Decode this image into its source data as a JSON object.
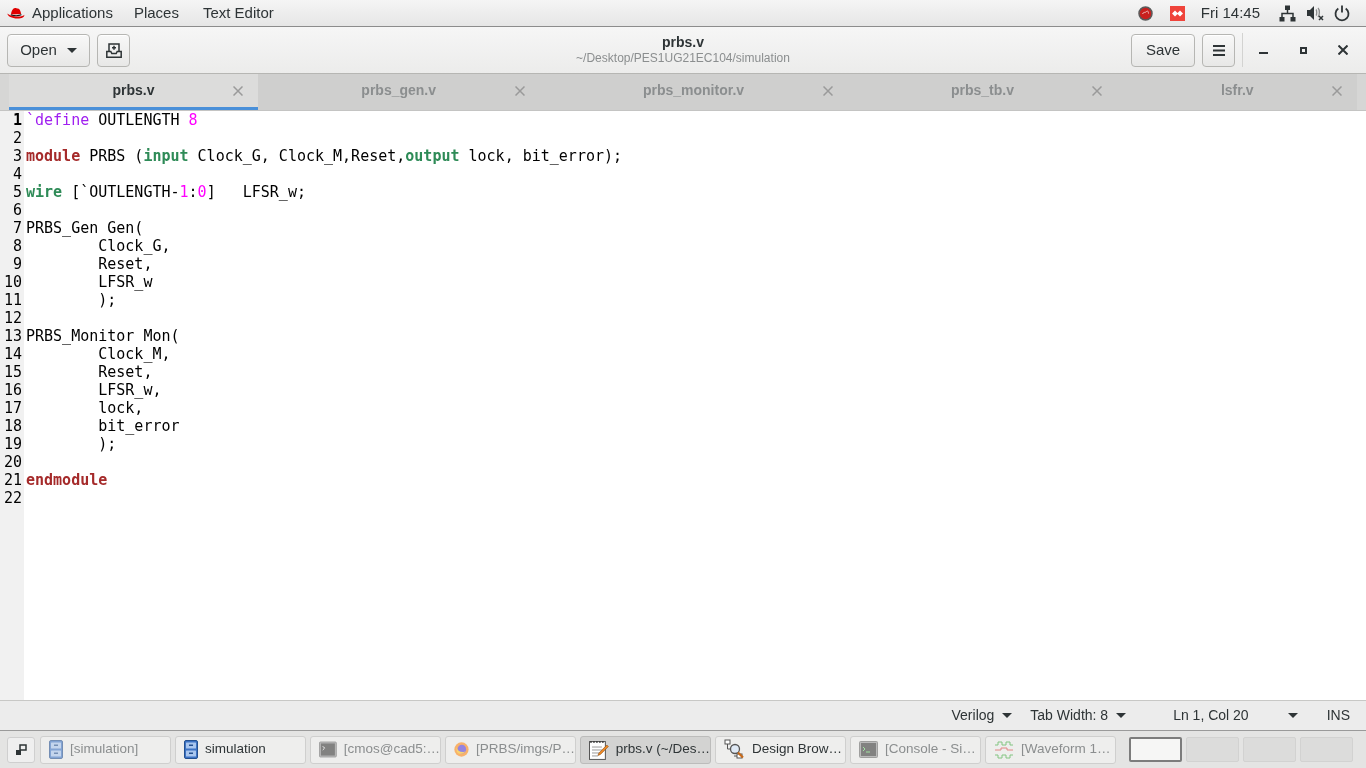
{
  "top_panel": {
    "applications_menu": "Applications",
    "places_menu": "Places",
    "app_menu": "Text Editor",
    "clock": "Fri 14:45"
  },
  "header_bar": {
    "open_button": "Open",
    "title": "prbs.v",
    "subtitle": "~/Desktop/PES1UG21EC104/simulation",
    "save_button": "Save"
  },
  "tabs": [
    {
      "label": "prbs.v",
      "selected": true
    },
    {
      "label": "prbs_gen.v",
      "selected": false
    },
    {
      "label": "prbs_monitor.v",
      "selected": false
    },
    {
      "label": "prbs_tb.v",
      "selected": false
    },
    {
      "label": "lsfr.v",
      "selected": false
    }
  ],
  "editor": {
    "lines": [
      {
        "number": "1",
        "current": true,
        "tokens": [
          {
            "kind": "directive",
            "text": "`define"
          },
          {
            "kind": "plain",
            "text": " OUTLENGTH "
          },
          {
            "kind": "number",
            "text": "8"
          }
        ]
      },
      {
        "number": "2",
        "current": false
      },
      {
        "number": "3",
        "current": false,
        "tokens": [
          {
            "kind": "keyword",
            "text": "module"
          },
          {
            "kind": "plain",
            "text": " PRBS ("
          },
          {
            "kind": "type",
            "text": "input"
          },
          {
            "kind": "plain",
            "text": " Clock_G, Clock_M,Reset,"
          },
          {
            "kind": "type",
            "text": "output"
          },
          {
            "kind": "plain",
            "text": " lock, bit_error);"
          }
        ]
      },
      {
        "number": "4",
        "current": false
      },
      {
        "number": "5",
        "current": false,
        "tokens": [
          {
            "kind": "type",
            "text": "wire"
          },
          {
            "kind": "plain",
            "text": " [`OUTLENGTH-"
          },
          {
            "kind": "number",
            "text": "1"
          },
          {
            "kind": "plain",
            "text": ":"
          },
          {
            "kind": "number",
            "text": "0"
          },
          {
            "kind": "plain",
            "text": "]   LFSR_w;"
          }
        ]
      },
      {
        "number": "6",
        "current": false
      },
      {
        "number": "7",
        "current": false,
        "tokens": [
          {
            "kind": "plain",
            "text": "PRBS_Gen Gen("
          }
        ]
      },
      {
        "number": "8",
        "current": false,
        "tokens": [
          {
            "kind": "plain",
            "text": "        Clock_G,"
          }
        ]
      },
      {
        "number": "9",
        "current": false,
        "tokens": [
          {
            "kind": "plain",
            "text": "        Reset,"
          }
        ]
      },
      {
        "number": "10",
        "current": false,
        "tokens": [
          {
            "kind": "plain",
            "text": "        LFSR_w"
          }
        ]
      },
      {
        "number": "11",
        "current": false,
        "tokens": [
          {
            "kind": "plain",
            "text": "        );"
          }
        ]
      },
      {
        "number": "12",
        "current": false
      },
      {
        "number": "13",
        "current": false,
        "tokens": [
          {
            "kind": "plain",
            "text": "PRBS_Monitor Mon("
          }
        ]
      },
      {
        "number": "14",
        "current": false,
        "tokens": [
          {
            "kind": "plain",
            "text": "        Clock_M,"
          }
        ]
      },
      {
        "number": "15",
        "current": false,
        "tokens": [
          {
            "kind": "plain",
            "text": "        Reset,"
          }
        ]
      },
      {
        "number": "16",
        "current": false,
        "tokens": [
          {
            "kind": "plain",
            "text": "        LFSR_w,"
          }
        ]
      },
      {
        "number": "17",
        "current": false,
        "tokens": [
          {
            "kind": "plain",
            "text": "        lock,"
          }
        ]
      },
      {
        "number": "18",
        "current": false,
        "tokens": [
          {
            "kind": "plain",
            "text": "        bit_error"
          }
        ]
      },
      {
        "number": "19",
        "current": false,
        "tokens": [
          {
            "kind": "plain",
            "text": "        );"
          }
        ]
      },
      {
        "number": "20",
        "current": false
      },
      {
        "number": "21",
        "current": false,
        "tokens": [
          {
            "kind": "keyword",
            "text": "endmodule"
          }
        ]
      },
      {
        "number": "22",
        "current": false
      }
    ]
  },
  "status_bar": {
    "language": "Verilog",
    "tab_width": "Tab Width: 8",
    "cursor_position": "Ln 1, Col 20",
    "insert_mode": "INS"
  },
  "taskbar": {
    "tasks": [
      {
        "kind": "files",
        "label": "[simulation]",
        "minimized": true,
        "selected": false
      },
      {
        "kind": "files",
        "label": "simulation",
        "minimized": false,
        "selected": false
      },
      {
        "kind": "terminal",
        "label": "[cmos@cad5:…",
        "minimized": true,
        "selected": false
      },
      {
        "kind": "browser",
        "label": "[PRBS/imgs/P…",
        "minimized": true,
        "selected": false
      },
      {
        "kind": "editor",
        "label": "prbs.v (~/Des…",
        "minimized": false,
        "selected": true
      },
      {
        "kind": "design-browser",
        "label": "Design Brow…",
        "minimized": false,
        "selected": false
      },
      {
        "kind": "console",
        "label": "[Console - Si…",
        "minimized": true,
        "selected": false
      },
      {
        "kind": "waveform",
        "label": "[Waveform 1…",
        "minimized": true,
        "selected": false
      }
    ],
    "workspaces": [
      {
        "selected": true
      },
      {
        "selected": false
      },
      {
        "selected": false
      },
      {
        "selected": false
      }
    ]
  }
}
